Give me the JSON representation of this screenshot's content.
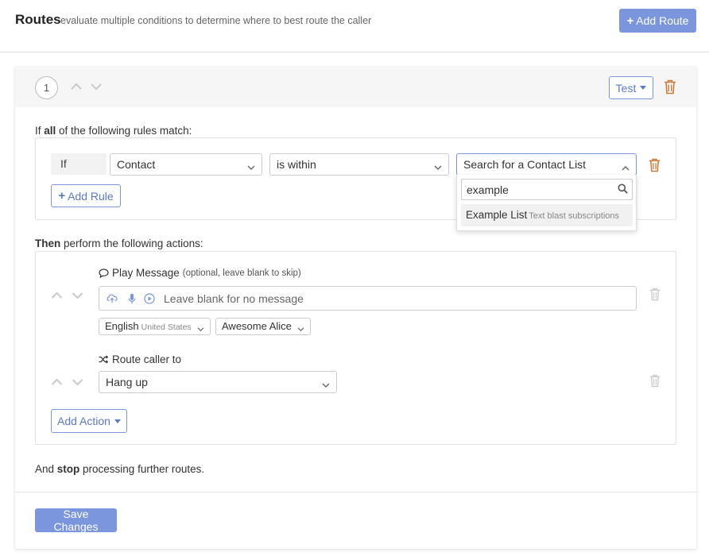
{
  "header": {
    "title": "Routes",
    "subtitle": "evaluate multiple conditions to determine where to best route the caller",
    "add_route_plus": "+",
    "add_route_label": "Add Route"
  },
  "route": {
    "number": "1",
    "test_label": "Test",
    "rules_heading_pre": "If ",
    "rules_heading_bold": "all",
    "rules_heading_post": " of the following rules match:",
    "rule": {
      "if_label": "If",
      "field": "Contact",
      "operator": "is within",
      "value_placeholder": "Search for a Contact List",
      "search_value": "example",
      "result_name": "Example List",
      "result_sub": "Text blast subscriptions"
    },
    "add_rule_plus": "+",
    "add_rule_label": "Add Rule",
    "actions_heading_bold": "Then",
    "actions_heading_post": " perform the following actions:",
    "play_message": {
      "title": "Play Message",
      "hint": "(optional, leave blank to skip)",
      "placeholder": "Leave blank for no message",
      "language": "English",
      "language_region": "United States",
      "voice": "Awesome Alice"
    },
    "route_caller": {
      "title": "Route caller to",
      "value": "Hang up"
    },
    "add_action_label": "Add Action",
    "footer_pre": "And ",
    "footer_bold": "stop",
    "footer_post": " processing further routes.",
    "save_label": "Save Changes"
  },
  "colors": {
    "accent": "#7b96dc",
    "trash": "#c77a3a",
    "muted_icon": "#cccccc"
  },
  "icons": [
    "plus-icon",
    "chevron-up-icon",
    "chevron-down-icon",
    "trash-icon",
    "search-icon",
    "speech-bubble-icon",
    "cloud-upload-icon",
    "microphone-icon",
    "play-circle-icon",
    "shuffle-icon"
  ]
}
